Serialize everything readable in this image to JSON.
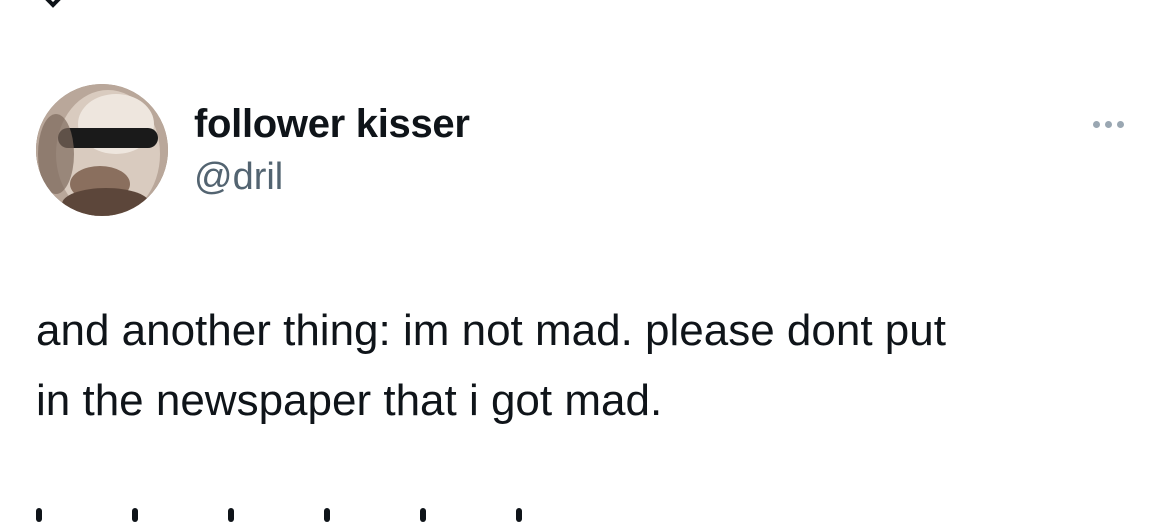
{
  "post": {
    "author": {
      "display_name": "follower kisser",
      "handle": "@dril"
    },
    "text": "and another thing: im not mad. please dont put\nin the newspaper that i got mad.",
    "more_icon": "more-horizontal-icon"
  },
  "colors": {
    "primary_text": "#0f1419",
    "secondary_text": "#536471",
    "more_icon": "#9aa7b2",
    "background": "#ffffff"
  }
}
